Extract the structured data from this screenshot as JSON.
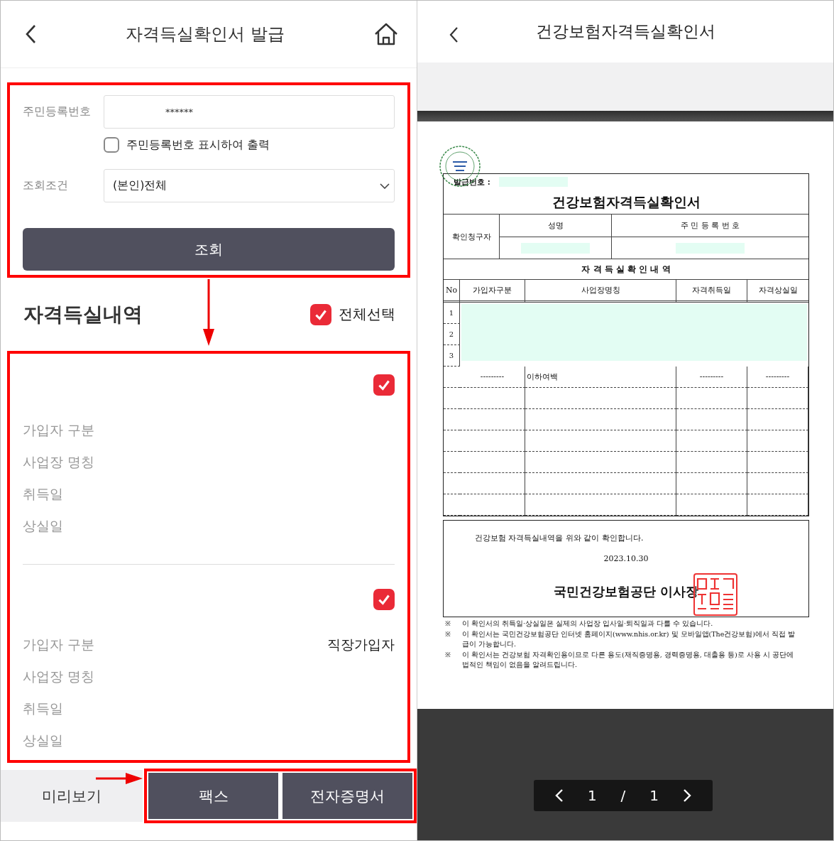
{
  "left_screen": {
    "header": {
      "title": "자격득실확인서 발급"
    },
    "form": {
      "resident_number": {
        "label": "주민등록번호",
        "value": "******"
      },
      "show_number": {
        "label": "주민등록번호 표시하여 출력",
        "checked": false
      },
      "query_condition": {
        "label": "조회조건",
        "value": "(본인)전체"
      },
      "query_button": "조회"
    },
    "history": {
      "title": "자격득실내역",
      "select_all": {
        "label": "전체선택",
        "checked": true
      },
      "records": [
        {
          "checked": true,
          "fields": [
            {
              "label": "가입자 구분"
            },
            {
              "label": "사업장 명칭"
            },
            {
              "label": "취득일"
            },
            {
              "label": "상실일"
            }
          ]
        },
        {
          "checked": true,
          "fields": [
            {
              "label": "가입자 구분",
              "value": "직장가입자"
            },
            {
              "label": "사업장 명칭"
            },
            {
              "label": "취득일"
            },
            {
              "label": "상실일"
            }
          ]
        }
      ]
    },
    "bottom_bar": [
      {
        "label": "미리보기",
        "kind": "secondary"
      },
      {
        "label": "팩스",
        "kind": "primary"
      },
      {
        "label": "전자증명서",
        "kind": "primary"
      }
    ]
  },
  "right_screen": {
    "header": {
      "title": "건강보험자격득실확인서"
    },
    "document": {
      "issue_number_label": "발급번호 :",
      "title": "건강보험자격득실확인서",
      "requester": {
        "label": "확인청구자",
        "columns": [
          "성명",
          "주 민 등 록 번 호"
        ]
      },
      "section_title": "자 격 득 실 확 인 내 역",
      "table": {
        "columns": [
          "No",
          "가입자구분",
          "사업장명칭",
          "자격취득일",
          "자격상실일"
        ],
        "rows": [
          "1",
          "2",
          "3"
        ],
        "end_row": [
          "---------",
          "이하여백",
          "---------",
          "---------"
        ]
      },
      "statement": "건강보험 자격득실내역을 위와 같이 확인합니다.",
      "date": "2023.10.30",
      "issuer": "국민건강보험공단 이사장",
      "notes": [
        {
          "mark": "※",
          "text": "이 확인서의 취득일·상실일은 실제의 사업장 입사일·퇴직일과 다를 수 있습니다."
        },
        {
          "mark": "※",
          "text": "이 확인서는 국민건강보험공단 인터넷 홈페이지(www.nhis.or.kr) 및 모바일앱(The건강보험)에서 직접 발급이 가능합니다."
        },
        {
          "mark": "※",
          "text": "이 확인서는 건강보험 자격확인용이므로 다른 용도(재직증명용, 경력증명용, 대출용 등)로 사용 시 공단에 법적인 책임이 없음을 알려드립니다."
        }
      ]
    },
    "pager": {
      "current": "1",
      "separator": "/",
      "total": "1"
    }
  }
}
